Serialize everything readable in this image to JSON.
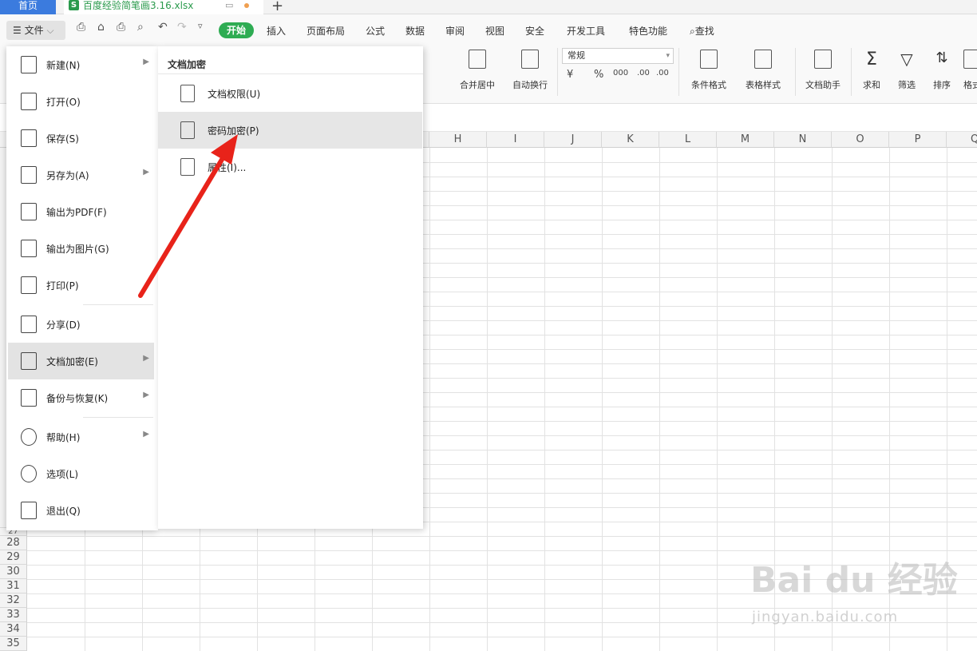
{
  "tabs": {
    "home": "首页",
    "file_name": "百度经验简笔画3.16.xlsx",
    "plus": "+"
  },
  "menubar": {
    "file_label": "文件",
    "tabs": [
      "开始",
      "插入",
      "页面布局",
      "公式",
      "数据",
      "审阅",
      "视图",
      "安全",
      "开发工具",
      "特色功能",
      "查找"
    ]
  },
  "ribbon": {
    "merge_center": "合并居中",
    "auto_wrap": "自动换行",
    "number_format": "常规",
    "currency": "¥",
    "percent": "%",
    "thousands": "000",
    "dec_inc": ".00",
    "dec_dec": ".00",
    "cond_format": "条件格式",
    "table_style": "表格样式",
    "doc_assistant": "文档助手",
    "sum": "求和",
    "filter": "筛选",
    "sort": "排序",
    "format": "格式"
  },
  "columns": [
    "H",
    "I",
    "J",
    "K",
    "L",
    "M",
    "N",
    "O",
    "P",
    "Q"
  ],
  "rows": [
    "27",
    "28",
    "29",
    "30",
    "31",
    "32",
    "33",
    "34",
    "35"
  ],
  "file_menu": {
    "items": [
      {
        "label": "新建(N)",
        "icon": "new-file-icon",
        "arrow": true
      },
      {
        "label": "打开(O)",
        "icon": "folder-icon",
        "arrow": false
      },
      {
        "label": "保存(S)",
        "icon": "save-icon",
        "arrow": false
      },
      {
        "label": "另存为(A)",
        "icon": "save-as-icon",
        "arrow": true
      },
      {
        "label": "输出为PDF(F)",
        "icon": "pdf-icon",
        "arrow": false
      },
      {
        "label": "输出为图片(G)",
        "icon": "image-icon",
        "arrow": false
      },
      {
        "label": "打印(P)",
        "icon": "print-icon",
        "arrow": false
      },
      {
        "label": "分享(D)",
        "icon": "share-icon",
        "arrow": false
      },
      {
        "label": "文档加密(E)",
        "icon": "encrypt-doc-icon",
        "arrow": true
      },
      {
        "label": "备份与恢复(K)",
        "icon": "backup-icon",
        "arrow": true
      },
      {
        "label": "帮助(H)",
        "icon": "help-icon",
        "arrow": true
      },
      {
        "label": "选项(L)",
        "icon": "settings-icon",
        "arrow": false
      },
      {
        "label": "退出(Q)",
        "icon": "exit-icon",
        "arrow": false
      }
    ]
  },
  "submenu": {
    "title": "文档加密",
    "items": [
      {
        "label": "文档权限(U)",
        "icon": "doc-permission-icon"
      },
      {
        "label": "密码加密(P)",
        "icon": "password-lock-icon"
      },
      {
        "label": "属性(I)...",
        "icon": "properties-icon"
      }
    ]
  },
  "watermark": {
    "brand": "Bai du 经验",
    "url": "jingyan.baidu.com"
  },
  "colors": {
    "accent": "#2eac53",
    "home_tab": "#3b7bde",
    "arrow": "#e8231a"
  }
}
